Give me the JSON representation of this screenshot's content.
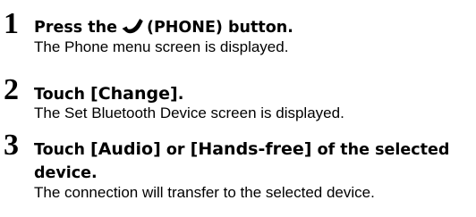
{
  "steps": [
    {
      "number": "1",
      "title_prefix": "Press the",
      "icon": "phone-icon",
      "title_suffix": "(PHONE) button.",
      "description": "The Phone menu screen is displayed."
    },
    {
      "number": "2",
      "title_prefix": "Touch",
      "title_bracket": "[Change]",
      "title_suffix": ".",
      "description": "The Set Bluetooth Device screen is displayed."
    },
    {
      "number": "3",
      "title_prefix": "Touch",
      "title_bracket_1": "[Audio]",
      "title_middle": "or",
      "title_bracket_2": "[Hands-free]",
      "title_suffix": "of the selected device.",
      "description": "The connection will transfer to the selected device."
    }
  ]
}
